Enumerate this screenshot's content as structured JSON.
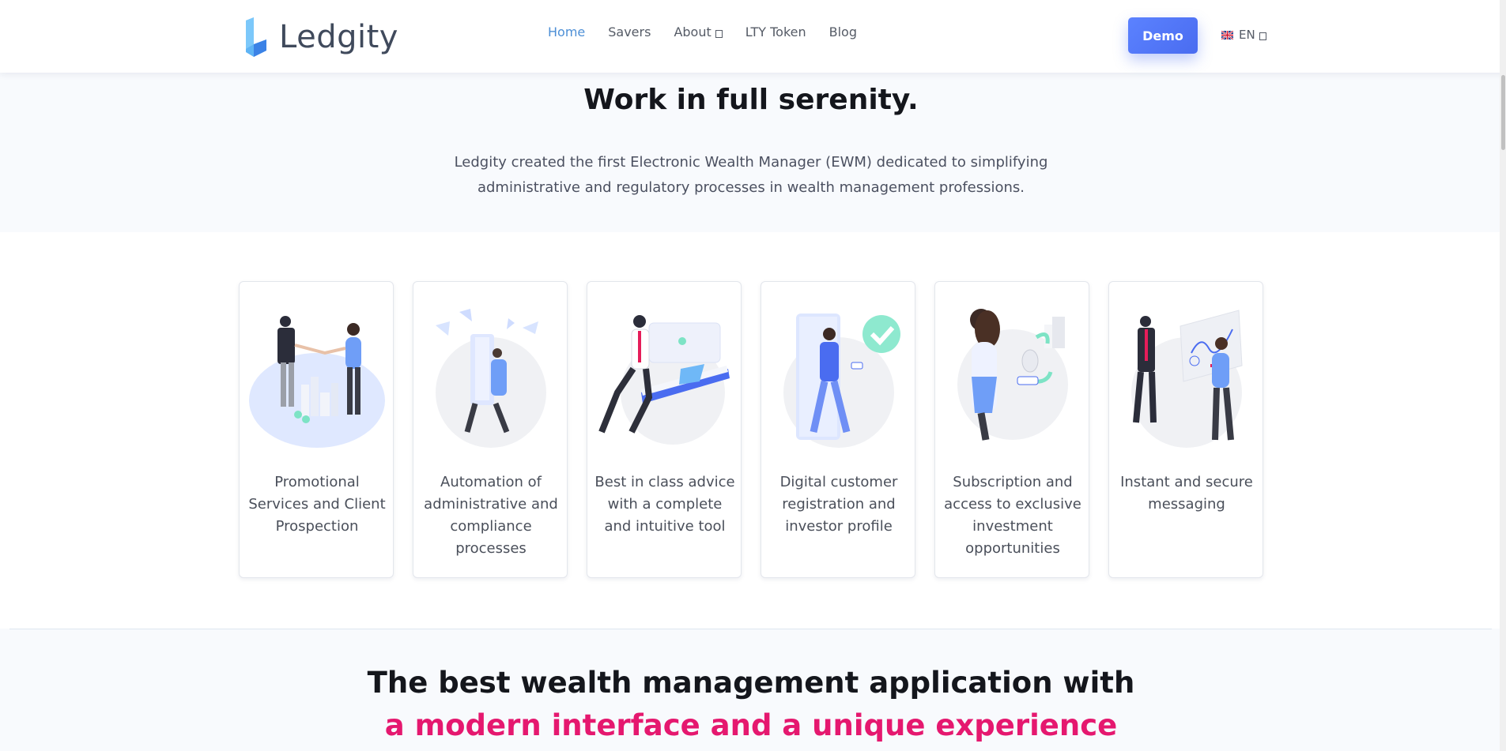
{
  "header": {
    "logo_text": "Ledgity",
    "nav": [
      {
        "label": "Home",
        "active": true,
        "has_dropdown": false
      },
      {
        "label": "Savers",
        "active": false,
        "has_dropdown": false
      },
      {
        "label": "About",
        "active": false,
        "has_dropdown": true
      },
      {
        "label": "LTY Token",
        "active": false,
        "has_dropdown": false
      },
      {
        "label": "Blog",
        "active": false,
        "has_dropdown": false
      }
    ],
    "demo_label": "Demo",
    "language": {
      "label": "EN",
      "flag_icon": "uk-flag-icon"
    }
  },
  "hero": {
    "title": "Work in full serenity.",
    "description": "Ledgity created the first Electronic Wealth Manager (EWM) dedicated to simplifying administrative and regulatory processes in wealth management professions."
  },
  "features": [
    {
      "label": "Promotional Services and Client Prospection",
      "icon": "handshake-illustration"
    },
    {
      "label": "Automation of administrative and compliance processes",
      "icon": "automation-illustration"
    },
    {
      "label": "Best in class advice with a complete and intuitive tool",
      "icon": "advisor-illustration"
    },
    {
      "label": "Digital customer registration and investor profile",
      "icon": "registration-illustration"
    },
    {
      "label": "Subscription and access to exclusive investment opportunities",
      "icon": "subscription-illustration"
    },
    {
      "label": "Instant and secure messaging",
      "icon": "messaging-illustration"
    }
  ],
  "bottom": {
    "title_line1": "The best wealth management application with",
    "title_line2": "a modern interface and a unique experience"
  },
  "colors": {
    "accent_blue": "#4d8fd6",
    "button_blue": "#4a6cf0",
    "accent_pink": "#e5186f"
  }
}
